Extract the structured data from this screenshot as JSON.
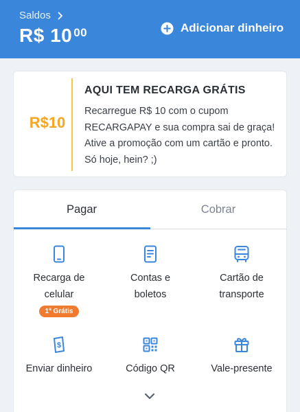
{
  "header": {
    "balance_label": "Saldos",
    "balance_main": "R$ 10",
    "balance_cents": "00",
    "add_money_label": "Adicionar dinheiro"
  },
  "promo": {
    "value": "R$10",
    "title": "AQUI TEM RECARGA GRÁTIS",
    "text": "Recarregue R$ 10 com o cupom RECARGAPAY e sua compra sai de graça! Ative a promoção com um cartão e pronto. Só hoje, hein? ;)"
  },
  "tabs": [
    {
      "label": "Pagar",
      "active": true
    },
    {
      "label": "Cobrar",
      "active": false
    }
  ],
  "actions": [
    {
      "label": "Recarga de celular",
      "icon": "phone-icon",
      "badge": "1ª Grátis"
    },
    {
      "label": "Contas e boletos",
      "icon": "bill-icon"
    },
    {
      "label": "Cartão de transporte",
      "icon": "bus-icon"
    },
    {
      "label": "Enviar dinheiro",
      "icon": "send-money-icon"
    },
    {
      "label": "Código QR",
      "icon": "qr-code-icon"
    },
    {
      "label": "Vale-presente",
      "icon": "gift-icon"
    }
  ],
  "colors": {
    "header_bg": "#3a86da",
    "accent": "#3a86da",
    "promo_value": "#f5a623",
    "promo_divider": "#f5c543",
    "badge_bg": "#f07a2e"
  }
}
